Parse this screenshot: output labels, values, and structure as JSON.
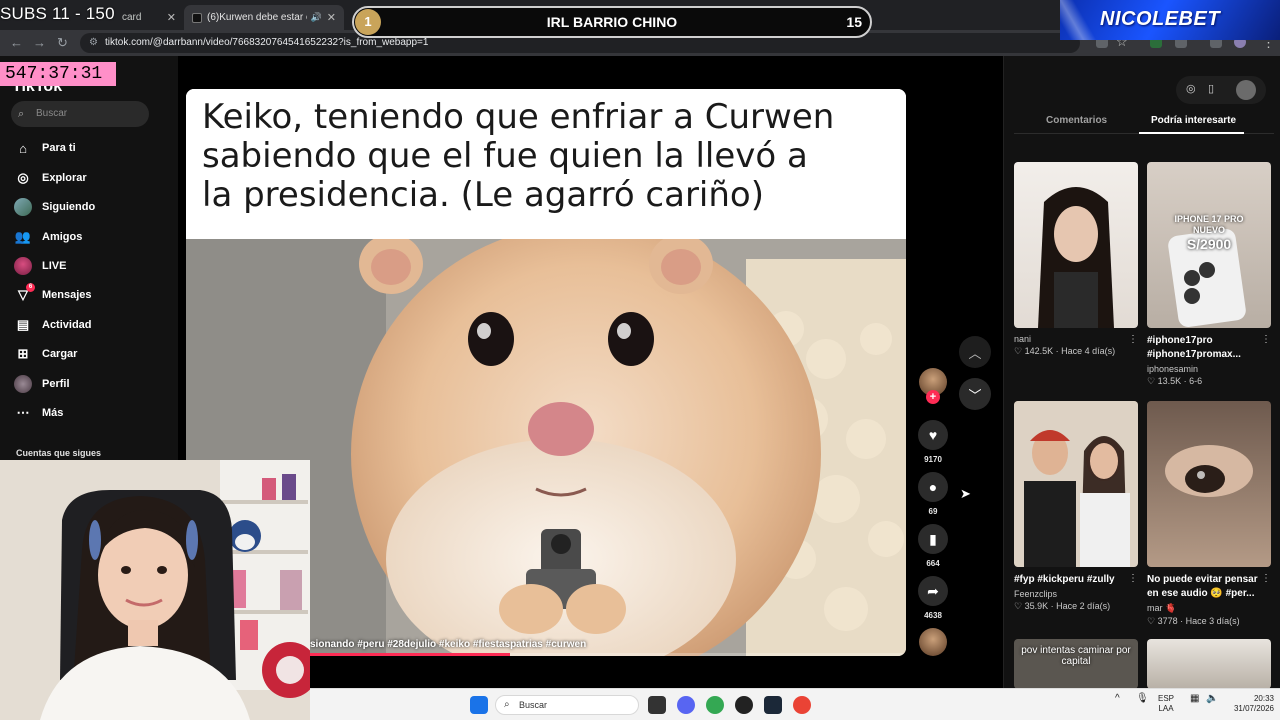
{
  "overlay": {
    "subs": "SUBS 11 - 150",
    "irl_badge": "1",
    "irl_title": "IRL BARRIO CHINO",
    "irl_count": "15",
    "brand": "NICOLEBET",
    "timer": "547:37:31"
  },
  "browser": {
    "tab1_fragment": "card",
    "tab2_title": "(6)Kurwen debe estar conve",
    "url": "tiktok.com/@darrbann/video/7668320764541652232?is_from_webapp=1"
  },
  "sidebar": {
    "logo": "TikTok",
    "search_placeholder": "Buscar",
    "items": [
      {
        "label": "Para ti",
        "icon": "home-icon"
      },
      {
        "label": "Explorar",
        "icon": "compass-icon"
      },
      {
        "label": "Siguiendo",
        "icon": "following-avatar-icon"
      },
      {
        "label": "Amigos",
        "icon": "friends-icon"
      },
      {
        "label": "LIVE",
        "icon": "live-icon"
      },
      {
        "label": "Mensajes",
        "icon": "messages-icon",
        "badge": "6"
      },
      {
        "label": "Actividad",
        "icon": "activity-icon"
      },
      {
        "label": "Cargar",
        "icon": "upload-icon"
      },
      {
        "label": "Perfil",
        "icon": "profile-icon"
      },
      {
        "label": "Más",
        "icon": "more-icon"
      }
    ],
    "following_header": "Cuentas que sigues"
  },
  "video": {
    "caption_line1": "Keiko, teniendo que enfriar a Curwen",
    "caption_line2": "sabiendo que el fue quien la llevó a",
    "caption_line3": "la presidencia. (Le agarró cariño)",
    "tags": "sionando #peru #28dejulio #keiko #fiestaspatrias #curwen",
    "progress": 0.45,
    "likes": "9170",
    "comments": "69",
    "saves": "664",
    "shares": "4638"
  },
  "right_panel": {
    "tab_comments": "Comentarios",
    "tab_suggested": "Podría interesarte",
    "cards": [
      {
        "thumb_text": "",
        "title": "",
        "author": "nani",
        "likes": "142.5K",
        "date": "Hace 4 día(s)"
      },
      {
        "thumb_text_1": "IPHONE 17 PRO",
        "thumb_text_2": "NUEVO",
        "thumb_text_3": "S/2900",
        "title": "#iphone17pro #iphone17promax...",
        "author": "iphonesamin",
        "likes": "13.5K",
        "date": "6-6"
      },
      {
        "thumb_text": "",
        "title": "#fyp #kickperu #zully",
        "author": "Feenzclips",
        "likes": "35.9K",
        "date": "Hace 2 día(s)"
      },
      {
        "thumb_text": "",
        "title": "No puede evitar pensar en ese audio 🥺 #per...",
        "author": "mar 🫀",
        "likes": "3778",
        "date": "Hace 3 día(s)"
      },
      {
        "thumb_text": "pov intentas caminar por capital"
      },
      {
        "thumb_text": ""
      }
    ]
  },
  "taskbar": {
    "search": "Buscar",
    "lang1": "ESP",
    "lang2": "LAA",
    "time": "20:33",
    "date": "31/07/2026"
  },
  "colors": {
    "accent": "#fe2c55",
    "timer_bg": "#ff8fc8",
    "brand_blue": "#1a55ff"
  }
}
